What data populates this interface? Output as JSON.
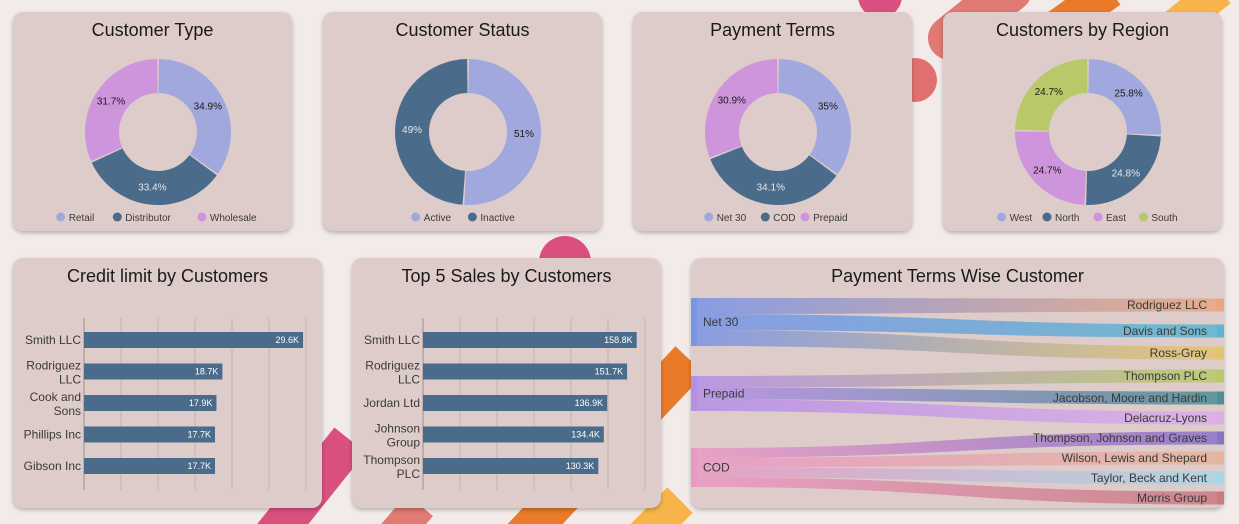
{
  "colors": {
    "periwinkle": "#a0a8dd",
    "slate": "#4a6b8a",
    "orchid": "#cf95dc",
    "olive": "#b9c96a",
    "card": "#ddccca",
    "background": "#f2ebe9"
  },
  "donuts": [
    {
      "title": "Customer Type",
      "slices": [
        {
          "label": "Retail",
          "value": 34.9,
          "pct": "34.9%",
          "color": "#a0a8dd"
        },
        {
          "label": "Distributor",
          "value": 33.4,
          "pct": "33.4%",
          "color": "#4a6b8a"
        },
        {
          "label": "Wholesale",
          "value": 31.7,
          "pct": "31.7%",
          "color": "#cf95dc"
        }
      ]
    },
    {
      "title": "Customer Status",
      "slices": [
        {
          "label": "Active",
          "value": 51,
          "pct": "51%",
          "color": "#a0a8dd"
        },
        {
          "label": "Inactive",
          "value": 49,
          "pct": "49%",
          "color": "#4a6b8a"
        }
      ]
    },
    {
      "title": "Payment Terms",
      "slices": [
        {
          "label": "Net 30",
          "value": 35,
          "pct": "35%",
          "color": "#a0a8dd"
        },
        {
          "label": "COD",
          "value": 34.1,
          "pct": "34.1%",
          "color": "#4a6b8a"
        },
        {
          "label": "Prepaid",
          "value": 30.9,
          "pct": "30.9%",
          "color": "#cf95dc"
        }
      ]
    },
    {
      "title": "Customers by Region",
      "slices": [
        {
          "label": "West",
          "value": 25.8,
          "pct": "25.8%",
          "color": "#a0a8dd"
        },
        {
          "label": "North",
          "value": 24.8,
          "pct": "24.8%",
          "color": "#4a6b8a"
        },
        {
          "label": "East",
          "value": 24.7,
          "pct": "24.7%",
          "color": "#cf95dc"
        },
        {
          "label": "South",
          "value": 24.7,
          "pct": "24.7%",
          "color": "#b9c96a"
        }
      ]
    }
  ],
  "credit_chart": {
    "title": "Credit limit by Customers",
    "bar_color": "#4a6b8a",
    "xmax": 30000,
    "bars": [
      {
        "name": [
          "Smith LLC"
        ],
        "value": 29600,
        "label": "29.6K"
      },
      {
        "name": [
          "Rodriguez",
          "LLC"
        ],
        "value": 18700,
        "label": "18.7K"
      },
      {
        "name": [
          "Cook and",
          "Sons"
        ],
        "value": 17900,
        "label": "17.9K"
      },
      {
        "name": [
          "Phillips Inc"
        ],
        "value": 17700,
        "label": "17.7K"
      },
      {
        "name": [
          "Gibson Inc"
        ],
        "value": 17700,
        "label": "17.7K"
      }
    ]
  },
  "sales_chart": {
    "title": "Top 5 Sales by Customers",
    "bar_color": "#4a6b8a",
    "xmax": 165000,
    "bars": [
      {
        "name": [
          "Smith LLC"
        ],
        "value": 158800,
        "label": "158.8K"
      },
      {
        "name": [
          "Rodriguez",
          "LLC"
        ],
        "value": 151700,
        "label": "151.7K"
      },
      {
        "name": [
          "Jordan Ltd"
        ],
        "value": 136900,
        "label": "136.9K"
      },
      {
        "name": [
          "Johnson",
          "Group"
        ],
        "value": 134400,
        "label": "134.4K"
      },
      {
        "name": [
          "Thompson",
          "PLC"
        ],
        "value": 130300,
        "label": "130.3K"
      }
    ]
  },
  "sankey": {
    "title": "Payment Terms Wise Customer",
    "sources": [
      {
        "label": "Net 30",
        "color": "#7a94e6"
      },
      {
        "label": "Prepaid",
        "color": "#b58ee6"
      },
      {
        "label": "COD",
        "color": "#e89ac4"
      }
    ],
    "targets": [
      {
        "label": "Rodriguez LLC",
        "source": 0,
        "color": "#e9a781"
      },
      {
        "label": "Davis and Sons",
        "source": 0,
        "color": "#5bb6cf"
      },
      {
        "label": "Ross-Gray",
        "source": 0,
        "color": "#e5c56c"
      },
      {
        "label": "Thompson PLC",
        "source": 1,
        "color": "#b9c96a"
      },
      {
        "label": "Jacobson, Moore and Hardin",
        "source": 1,
        "color": "#4e8e95"
      },
      {
        "label": "Delacruz-Lyons",
        "source": 1,
        "color": "#dcaee8"
      },
      {
        "label": "Thompson, Johnson and Graves",
        "source": 2,
        "color": "#8a72c8"
      },
      {
        "label": "Wilson, Lewis and Shepard",
        "source": 2,
        "color": "#e4b49d"
      },
      {
        "label": "Taylor, Beck and Kent",
        "source": 2,
        "color": "#a9d6e6"
      },
      {
        "label": "Morris Group",
        "source": 2,
        "color": "#c97a80"
      }
    ]
  },
  "chart_data": [
    {
      "type": "pie",
      "title": "Customer Type",
      "categories": [
        "Retail",
        "Distributor",
        "Wholesale"
      ],
      "values": [
        34.9,
        33.4,
        31.7
      ],
      "legend": "bottom"
    },
    {
      "type": "pie",
      "title": "Customer Status",
      "categories": [
        "Active",
        "Inactive"
      ],
      "values": [
        51,
        49
      ],
      "legend": "bottom"
    },
    {
      "type": "pie",
      "title": "Payment Terms",
      "categories": [
        "Net 30",
        "COD",
        "Prepaid"
      ],
      "values": [
        35,
        34.1,
        30.9
      ],
      "legend": "bottom"
    },
    {
      "type": "pie",
      "title": "Customers by Region",
      "categories": [
        "West",
        "North",
        "East",
        "South"
      ],
      "values": [
        25.8,
        24.8,
        24.7,
        24.7
      ],
      "legend": "bottom"
    },
    {
      "type": "bar",
      "title": "Credit limit by Customers",
      "categories": [
        "Smith LLC",
        "Rodriguez LLC",
        "Cook and Sons",
        "Phillips Inc",
        "Gibson Inc"
      ],
      "values": [
        29600,
        18700,
        17900,
        17700,
        17700
      ],
      "grid": true
    },
    {
      "type": "bar",
      "title": "Top 5 Sales by Customers",
      "categories": [
        "Smith LLC",
        "Rodriguez LLC",
        "Jordan Ltd",
        "Johnson Group",
        "Thompson PLC"
      ],
      "values": [
        158800,
        151700,
        136900,
        134400,
        130300
      ],
      "grid": true
    }
  ]
}
